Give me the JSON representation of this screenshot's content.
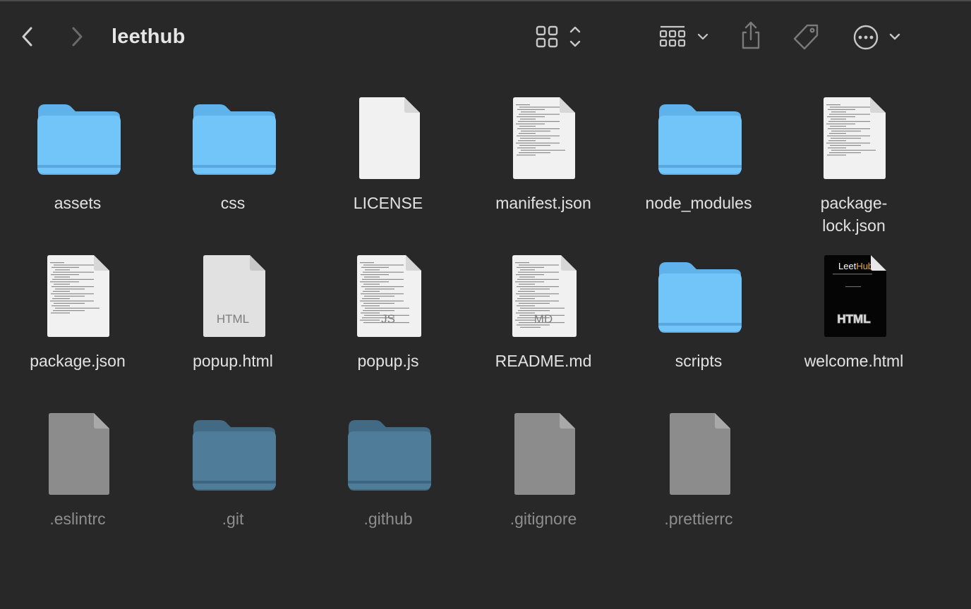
{
  "window": {
    "title": "leethub"
  },
  "toolbar": {
    "back": "chevron-left-icon",
    "forward": "chevron-right-icon",
    "view_mode": "icon-grid-view-icon",
    "group": "group-by-icon",
    "share": "share-icon",
    "tags": "tag-icon",
    "more": "ellipsis-circle-icon"
  },
  "files": [
    {
      "name": "assets",
      "kind": "folder"
    },
    {
      "name": "css",
      "kind": "folder"
    },
    {
      "name": "LICENSE",
      "kind": "doc-blank"
    },
    {
      "name": "manifest.json",
      "kind": "doc-text"
    },
    {
      "name": "node_modules",
      "kind": "folder"
    },
    {
      "name": "package-\nlock.json",
      "kind": "doc-text"
    },
    {
      "name": "package.json",
      "kind": "doc-text"
    },
    {
      "name": "popup.html",
      "kind": "doc-html",
      "badge": "HTML"
    },
    {
      "name": "popup.js",
      "kind": "doc-js",
      "badge": "JS"
    },
    {
      "name": "README.md",
      "kind": "doc-md",
      "badge": "MD"
    },
    {
      "name": "scripts",
      "kind": "folder"
    },
    {
      "name": "welcome.html",
      "kind": "doc-dark",
      "badge": "HTML",
      "preview_text": "LeetHub"
    },
    {
      "name": ".eslintrc",
      "kind": "doc-hidden"
    },
    {
      "name": ".git",
      "kind": "folder-hidden"
    },
    {
      "name": ".github",
      "kind": "folder-hidden"
    },
    {
      "name": ".gitignore",
      "kind": "doc-hidden"
    },
    {
      "name": ".prettierrc",
      "kind": "doc-hidden"
    }
  ],
  "colors": {
    "background": "#282828",
    "folder": "#6cc3f7",
    "folder_hidden": "#4e7a96",
    "doc": "#f2f2f2",
    "doc_hidden": "#8a8a8a",
    "accent_orange": "#f5a623"
  }
}
